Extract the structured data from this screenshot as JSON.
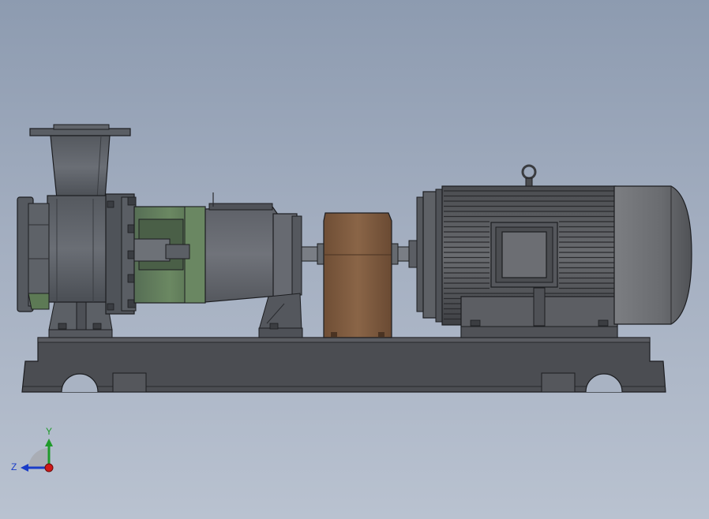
{
  "colors": {
    "background_top": "#8d9bb0",
    "background_bottom": "#b9c2d0",
    "pump_casing": "#5f636b",
    "bearing_frame": "#5d7a55",
    "coupling_guard": "#7e5a3f",
    "motor": "#5a5c60",
    "baseplate": "#4b4d52",
    "axis_x": "#d01818",
    "axis_y": "#1f9a2a",
    "axis_z": "#1a3cc8"
  },
  "triad": {
    "y_label": "Y",
    "z_label": "Z"
  }
}
